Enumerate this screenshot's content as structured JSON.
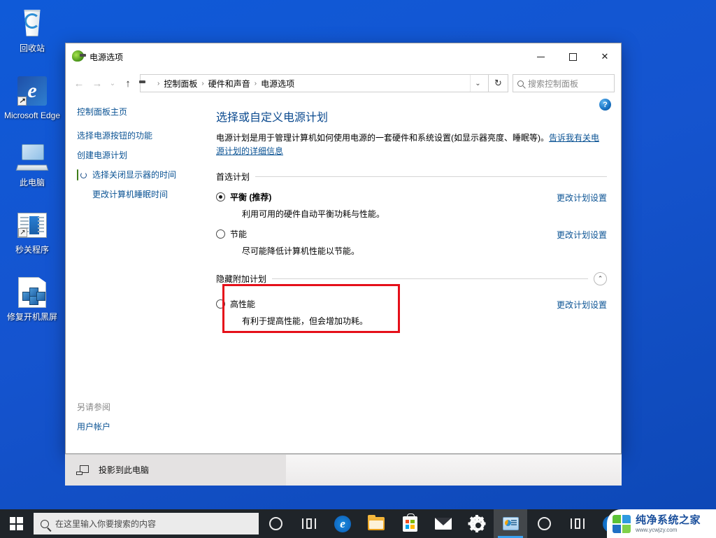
{
  "desktop": {
    "icons": [
      {
        "label": "回收站",
        "icon": "recycle-bin-icon"
      },
      {
        "label": "Microsoft Edge",
        "icon": "edge-icon"
      },
      {
        "label": "此电脑",
        "icon": "this-pc-icon"
      },
      {
        "label": "秒关程序",
        "icon": "app-shortcut-icon"
      },
      {
        "label": "修复开机黑屏",
        "icon": "repair-blackscreen-icon"
      }
    ]
  },
  "window": {
    "title": "电源选项",
    "title_icon": "power-plug-icon",
    "controls": {
      "minimize": "—",
      "maximize": "□",
      "close": "✕"
    },
    "address": {
      "back_icon": "back-arrow-icon",
      "forward_icon": "forward-arrow-icon",
      "recent_icon": "chevron-down-icon",
      "up_icon": "up-arrow-icon",
      "location_icon": "power-plug-icon",
      "breadcrumbs": [
        "控制面板",
        "硬件和声音",
        "电源选项"
      ],
      "separator": "›",
      "dropdown_icon": "chevron-down-icon",
      "refresh_icon": "refresh-icon"
    },
    "search": {
      "placeholder": "搜索控制面板",
      "icon": "search-icon",
      "value": ""
    }
  },
  "sidebar": {
    "home": "控制面板主页",
    "items": [
      {
        "label": "选择电源按钮的功能",
        "icon": null
      },
      {
        "label": "创建电源计划",
        "icon": null
      },
      {
        "label": "选择关闭显示器的时间",
        "icon": "shield-clock-icon"
      },
      {
        "label": "更改计算机睡眠时间",
        "icon": "moon-icon"
      }
    ],
    "see_also": {
      "header": "另请参阅",
      "links": [
        "用户帐户"
      ]
    }
  },
  "main": {
    "help_icon": "help-icon",
    "title": "选择或自定义电源计划",
    "description_before": "电源计划是用于管理计算机如何使用电源的一套硬件和系统设置(如显示器亮度、睡眠等)。",
    "description_link": "告诉我有关电源计划的详细信息",
    "groups": [
      {
        "label": "首选计划",
        "collapse_icon": null,
        "plans": [
          {
            "name": "平衡 (推荐)",
            "desc": "利用可用的硬件自动平衡功耗与性能。",
            "selected": true,
            "action": "更改计划设置",
            "highlighted": false
          },
          {
            "name": "节能",
            "desc": "尽可能降低计算机性能以节能。",
            "selected": false,
            "action": "更改计划设置",
            "highlighted": false
          }
        ]
      },
      {
        "label": "隐藏附加计划",
        "collapse_icon": "chevron-up-icon",
        "plans": [
          {
            "name": "高性能",
            "desc": "有利于提高性能，但会增加功耗。",
            "selected": false,
            "action": "更改计划设置",
            "highlighted": true
          }
        ]
      }
    ]
  },
  "project_bar": {
    "label": "投影到此电脑",
    "icon": "project-screen-icon"
  },
  "taskbar": {
    "start_icon": "windows-logo-icon",
    "search_placeholder": "在这里输入你要搜索的内容",
    "search_icon": "search-icon",
    "search_value": "",
    "items": [
      {
        "icon": "cortana-icon",
        "active": false
      },
      {
        "icon": "task-view-icon",
        "active": false
      },
      {
        "icon": "edge-icon",
        "active": false
      },
      {
        "icon": "file-explorer-icon",
        "active": false
      },
      {
        "icon": "microsoft-store-icon",
        "active": false
      },
      {
        "icon": "mail-icon",
        "active": false
      },
      {
        "icon": "settings-gear-icon",
        "active": false
      },
      {
        "icon": "power-options-icon",
        "active": true
      },
      {
        "icon": "cortana-icon",
        "active": false
      },
      {
        "icon": "task-view-icon",
        "active": false
      },
      {
        "icon": "edge-icon",
        "active": false
      }
    ]
  },
  "watermark": {
    "name": "纯净系统之家",
    "url": "www.ycwjzy.com",
    "logo": "site-logo-icon"
  },
  "colors": {
    "desktop": "#1554cf",
    "accent_link": "#0b5394",
    "highlight_red": "#e5101a",
    "taskbar": "#1f2429"
  }
}
